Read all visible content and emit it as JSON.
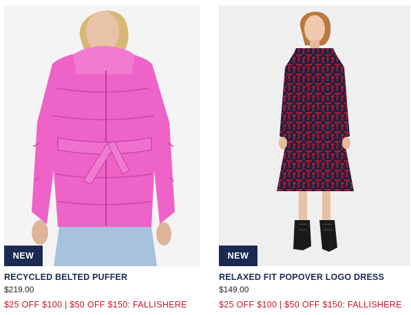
{
  "products": [
    {
      "badge": "NEW",
      "title": "RECYCLED BELTED PUFFER",
      "price": "$219.00",
      "promo": "$25 OFF $100 | $50 OFF $150: FALLISHERE",
      "image_subject": "woman-in-pink-belted-puffer-jacket",
      "accent_color": "#ec5fc4"
    },
    {
      "badge": "NEW",
      "title": "RELAXED FIT POPOVER LOGO DRESS",
      "price": "$149.00",
      "promo": "$25 OFF $100 | $50 OFF $150: FALLISHERE",
      "image_subject": "woman-in-red-navy-logo-dress",
      "accent_color": "#9c1830"
    }
  ],
  "colors": {
    "badge_bg": "#1b2a52",
    "title": "#1b2a52",
    "promo": "#c8102e"
  }
}
